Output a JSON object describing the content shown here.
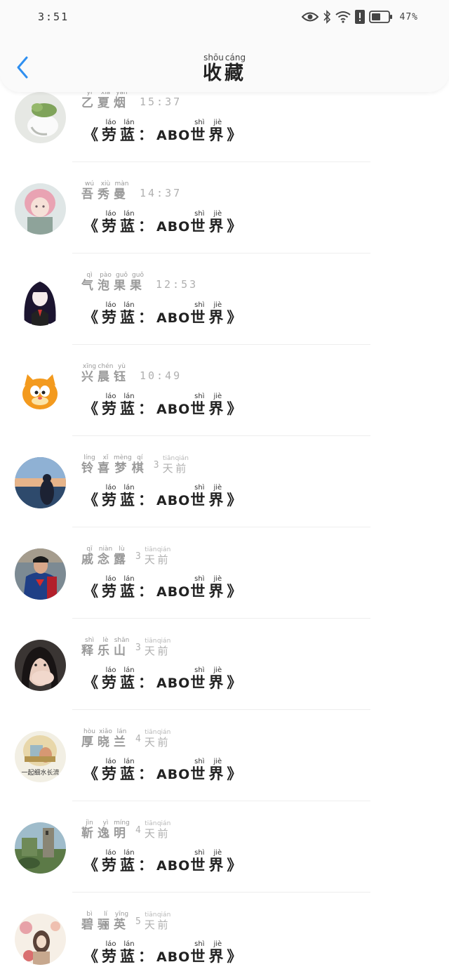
{
  "status_bar": {
    "time": "3:51",
    "battery": "47%"
  },
  "header": {
    "title_chars": [
      {
        "char": "收",
        "pinyin": "shōu"
      },
      {
        "char": "藏",
        "pinyin": "cáng"
      }
    ]
  },
  "colors": {
    "accent": "#2f8ff0",
    "name": "#9a9a9a",
    "content": "#222222"
  },
  "items": [
    {
      "avatar": "avatar-plant",
      "name": [
        {
          "c": "乙",
          "p": "yǐ"
        },
        {
          "c": "夏",
          "p": "xià"
        },
        {
          "c": "烟",
          "p": "yān"
        }
      ],
      "time": "15:37",
      "time_chars": null,
      "content_pre": [
        {
          "c": "《",
          "p": ""
        },
        {
          "c": "劳",
          "p": "láo"
        },
        {
          "c": "蓝",
          "p": "lán"
        },
        {
          "c": "：",
          "p": ""
        }
      ],
      "content_latin": "ABO",
      "content_post": [
        {
          "c": "世",
          "p": "shì"
        },
        {
          "c": "界",
          "p": "jiè"
        },
        {
          "c": "》",
          "p": ""
        }
      ]
    },
    {
      "avatar": "avatar-anime-girl",
      "name": [
        {
          "c": "吾",
          "p": "wú"
        },
        {
          "c": "秀",
          "p": "xiù"
        },
        {
          "c": "曼",
          "p": "màn"
        }
      ],
      "time": "14:37",
      "time_chars": null,
      "content_pre": [
        {
          "c": "《",
          "p": ""
        },
        {
          "c": "劳",
          "p": "láo"
        },
        {
          "c": "蓝",
          "p": "lán"
        },
        {
          "c": "：",
          "p": ""
        }
      ],
      "content_latin": "ABO",
      "content_post": [
        {
          "c": "世",
          "p": "shì"
        },
        {
          "c": "界",
          "p": "jiè"
        },
        {
          "c": "》",
          "p": ""
        }
      ]
    },
    {
      "avatar": "avatar-dark-hair",
      "name": [
        {
          "c": "气",
          "p": "qì"
        },
        {
          "c": "泡",
          "p": "pào"
        },
        {
          "c": "果",
          "p": "guǒ"
        },
        {
          "c": "果",
          "p": "guǒ"
        }
      ],
      "time": "12:53",
      "time_chars": null,
      "content_pre": [
        {
          "c": "《",
          "p": ""
        },
        {
          "c": "劳",
          "p": "láo"
        },
        {
          "c": "蓝",
          "p": "lán"
        },
        {
          "c": "：",
          "p": ""
        }
      ],
      "content_latin": "ABO",
      "content_post": [
        {
          "c": "世",
          "p": "shì"
        },
        {
          "c": "界",
          "p": "jiè"
        },
        {
          "c": "》",
          "p": ""
        }
      ]
    },
    {
      "avatar": "avatar-cat",
      "name": [
        {
          "c": "兴",
          "p": "xīng"
        },
        {
          "c": "晨",
          "p": "chén"
        },
        {
          "c": "钰",
          "p": "yù"
        }
      ],
      "time": "10:49",
      "time_chars": null,
      "content_pre": [
        {
          "c": "《",
          "p": ""
        },
        {
          "c": "劳",
          "p": "láo"
        },
        {
          "c": "蓝",
          "p": "lán"
        },
        {
          "c": "：",
          "p": ""
        }
      ],
      "content_latin": "ABO",
      "content_post": [
        {
          "c": "世",
          "p": "shì"
        },
        {
          "c": "界",
          "p": "jiè"
        },
        {
          "c": "》",
          "p": ""
        }
      ]
    },
    {
      "avatar": "avatar-sky",
      "name": [
        {
          "c": "铃",
          "p": "líng"
        },
        {
          "c": "喜",
          "p": "xǐ"
        },
        {
          "c": "梦",
          "p": "mèng"
        },
        {
          "c": "棋",
          "p": "qí"
        }
      ],
      "time": "3",
      "time_chars": [
        {
          "c": "天",
          "p": "tiān"
        },
        {
          "c": "前",
          "p": "qián"
        }
      ],
      "content_pre": [
        {
          "c": "《",
          "p": ""
        },
        {
          "c": "劳",
          "p": "láo"
        },
        {
          "c": "蓝",
          "p": "lán"
        },
        {
          "c": "：",
          "p": ""
        }
      ],
      "content_latin": "ABO",
      "content_post": [
        {
          "c": "世",
          "p": "shì"
        },
        {
          "c": "界",
          "p": "jiè"
        },
        {
          "c": "》",
          "p": ""
        }
      ]
    },
    {
      "avatar": "avatar-hero",
      "name": [
        {
          "c": "戚",
          "p": "qī"
        },
        {
          "c": "念",
          "p": "niàn"
        },
        {
          "c": "露",
          "p": "lù"
        }
      ],
      "time": "3",
      "time_chars": [
        {
          "c": "天",
          "p": "tiān"
        },
        {
          "c": "前",
          "p": "qián"
        }
      ],
      "content_pre": [
        {
          "c": "《",
          "p": ""
        },
        {
          "c": "劳",
          "p": "láo"
        },
        {
          "c": "蓝",
          "p": "lán"
        },
        {
          "c": "：",
          "p": ""
        }
      ],
      "content_latin": "ABO",
      "content_post": [
        {
          "c": "世",
          "p": "shì"
        },
        {
          "c": "界",
          "p": "jiè"
        },
        {
          "c": "》",
          "p": ""
        }
      ]
    },
    {
      "avatar": "avatar-selfie",
      "name": [
        {
          "c": "释",
          "p": "shì"
        },
        {
          "c": "乐",
          "p": "lè"
        },
        {
          "c": "山",
          "p": "shān"
        }
      ],
      "time": "3",
      "time_chars": [
        {
          "c": "天",
          "p": "tiān"
        },
        {
          "c": "前",
          "p": "qián"
        }
      ],
      "content_pre": [
        {
          "c": "《",
          "p": ""
        },
        {
          "c": "劳",
          "p": "láo"
        },
        {
          "c": "蓝",
          "p": "lán"
        },
        {
          "c": "：",
          "p": ""
        }
      ],
      "content_latin": "ABO",
      "content_post": [
        {
          "c": "世",
          "p": "shì"
        },
        {
          "c": "界",
          "p": "jiè"
        },
        {
          "c": "》",
          "p": ""
        }
      ]
    },
    {
      "avatar": "avatar-painting",
      "avatar_caption": "一起细水长流",
      "name": [
        {
          "c": "厚",
          "p": "hòu"
        },
        {
          "c": "晓",
          "p": "xiǎo"
        },
        {
          "c": "兰",
          "p": "lán"
        }
      ],
      "time": "4",
      "time_chars": [
        {
          "c": "天",
          "p": "tiān"
        },
        {
          "c": "前",
          "p": "qián"
        }
      ],
      "content_pre": [
        {
          "c": "《",
          "p": ""
        },
        {
          "c": "劳",
          "p": "láo"
        },
        {
          "c": "蓝",
          "p": "lán"
        },
        {
          "c": "：",
          "p": ""
        }
      ],
      "content_latin": "ABO",
      "content_post": [
        {
          "c": "世",
          "p": "shì"
        },
        {
          "c": "界",
          "p": "jiè"
        },
        {
          "c": "》",
          "p": ""
        }
      ]
    },
    {
      "avatar": "avatar-ruins",
      "name": [
        {
          "c": "靳",
          "p": "jìn"
        },
        {
          "c": "逸",
          "p": "yì"
        },
        {
          "c": "明",
          "p": "míng"
        }
      ],
      "time": "4",
      "time_chars": [
        {
          "c": "天",
          "p": "tiān"
        },
        {
          "c": "前",
          "p": "qián"
        }
      ],
      "content_pre": [
        {
          "c": "《",
          "p": ""
        },
        {
          "c": "劳",
          "p": "láo"
        },
        {
          "c": "蓝",
          "p": "lán"
        },
        {
          "c": "：",
          "p": ""
        }
      ],
      "content_latin": "ABO",
      "content_post": [
        {
          "c": "世",
          "p": "shì"
        },
        {
          "c": "界",
          "p": "jiè"
        },
        {
          "c": "》",
          "p": ""
        }
      ]
    },
    {
      "avatar": "avatar-flowers",
      "name": [
        {
          "c": "碧",
          "p": "bì"
        },
        {
          "c": "骊",
          "p": "lí"
        },
        {
          "c": "英",
          "p": "yīng"
        }
      ],
      "time": "5",
      "time_chars": [
        {
          "c": "天",
          "p": "tiān"
        },
        {
          "c": "前",
          "p": "qián"
        }
      ],
      "content_pre": [
        {
          "c": "《",
          "p": ""
        },
        {
          "c": "劳",
          "p": "láo"
        },
        {
          "c": "蓝",
          "p": "lán"
        },
        {
          "c": "：",
          "p": ""
        }
      ],
      "content_latin": "ABO",
      "content_post": [
        {
          "c": "世",
          "p": "shì"
        },
        {
          "c": "界",
          "p": "jiè"
        },
        {
          "c": "》",
          "p": ""
        }
      ]
    }
  ]
}
